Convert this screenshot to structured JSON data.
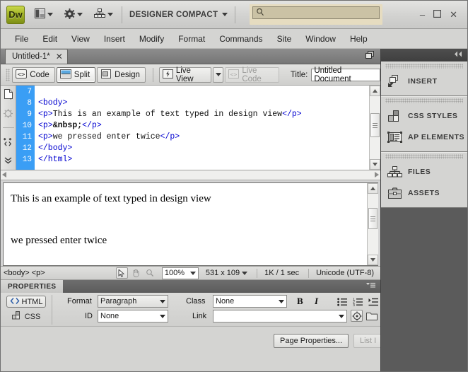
{
  "titlebar": {
    "logo": "Dw",
    "layout_icon": "layout-switcher-icon",
    "settings_icon": "gear-icon",
    "site_icon": "site-tree-icon",
    "workspace": "DESIGNER COMPACT",
    "search_placeholder": "",
    "search_value": "",
    "search_icon": "search-icon",
    "minimize": "–",
    "maximize": "☐",
    "close": "✕"
  },
  "menubar": {
    "items": [
      "File",
      "Edit",
      "View",
      "Insert",
      "Modify",
      "Format",
      "Commands",
      "Site",
      "Window",
      "Help"
    ]
  },
  "doctab": {
    "title": "Untitled-1*",
    "close": "✕",
    "restore_icon": "restore-window-icon"
  },
  "doctoolbar": {
    "code_label": "Code",
    "split_label": "Split",
    "design_label": "Design",
    "live_view_label": "Live View",
    "live_code_label": "Live Code",
    "title_label": "Title:",
    "title_value": "Untitled Document",
    "active_view": "Split"
  },
  "coding_toolbar": {
    "items": [
      {
        "name": "open-documents-icon"
      },
      {
        "name": "file-management-icon"
      },
      {
        "name": "collapse-full-tag-icon"
      },
      {
        "name": "more-options-icon"
      }
    ]
  },
  "code": {
    "lines": [
      {
        "num": "7",
        "segments": []
      },
      {
        "num": "8",
        "segments": [
          {
            "t": "<body>",
            "c": "tag"
          }
        ]
      },
      {
        "num": "9",
        "segments": [
          {
            "t": "<p>",
            "c": "tag"
          },
          {
            "t": "This is an example of text typed in design view",
            "c": "txt"
          },
          {
            "t": "</p>",
            "c": "tag"
          }
        ]
      },
      {
        "num": "10",
        "segments": [
          {
            "t": "<p>",
            "c": "tag"
          },
          {
            "t": "&nbsp;",
            "c": "ent"
          },
          {
            "t": "</p>",
            "c": "tag"
          }
        ]
      },
      {
        "num": "11",
        "segments": [
          {
            "t": "<p>",
            "c": "tag"
          },
          {
            "t": "we pressed enter twice",
            "c": "txt"
          },
          {
            "t": "</p>",
            "c": "tag"
          }
        ]
      },
      {
        "num": "12",
        "segments": [
          {
            "t": "</body>",
            "c": "tag"
          }
        ]
      },
      {
        "num": "13",
        "segments": [
          {
            "t": "</html>",
            "c": "tag"
          }
        ]
      }
    ]
  },
  "design": {
    "paragraph1": "This is an example of text typed in design view",
    "paragraph2": "we pressed enter twice"
  },
  "statusbar": {
    "tag_selector": "<body> <p>",
    "select_tool_icon": "select-arrow-icon",
    "hand_tool_icon": "hand-icon",
    "zoom_tool_icon": "magnifier-icon",
    "zoom_value": "100%",
    "window_size": "531 x 109",
    "download_size": "1K / 1 sec",
    "encoding": "Unicode (UTF-8)"
  },
  "properties": {
    "panel_title": "PROPERTIES",
    "panel_menu_icon": "panel-menu-icon",
    "html_button": "HTML",
    "css_button": "CSS",
    "format_label": "Format",
    "format_value": "Paragraph",
    "id_label": "ID",
    "id_value": "None",
    "class_label": "Class",
    "class_value": "None",
    "link_label": "Link",
    "link_value": "",
    "bold": "B",
    "italic": "I",
    "ul_icon": "unordered-list-icon",
    "ol_icon": "ordered-list-icon",
    "indent_icon": "indent-icon",
    "point_to_file_icon": "point-to-file-icon",
    "browse_folder_icon": "browse-folder-icon",
    "page_properties_button": "Page Properties...",
    "list_item_button": "List I"
  },
  "dock": {
    "collapse_icon": "collapse-panels-icon",
    "groups": [
      {
        "items": [
          {
            "label": "INSERT",
            "icon": "insert-icon"
          }
        ]
      },
      {
        "items": [
          {
            "label": "CSS STYLES",
            "icon": "css-styles-icon"
          },
          {
            "label": "AP ELEMENTS",
            "icon": "ap-elements-icon"
          }
        ]
      },
      {
        "items": [
          {
            "label": "FILES",
            "icon": "files-icon"
          },
          {
            "label": "ASSETS",
            "icon": "assets-icon"
          }
        ]
      }
    ]
  },
  "colors": {
    "gutter_selection": "#3a9ef5",
    "tag_color": "#0000d0",
    "chrome": "#d4d4d2",
    "dock_bg": "#5b5b5b"
  }
}
